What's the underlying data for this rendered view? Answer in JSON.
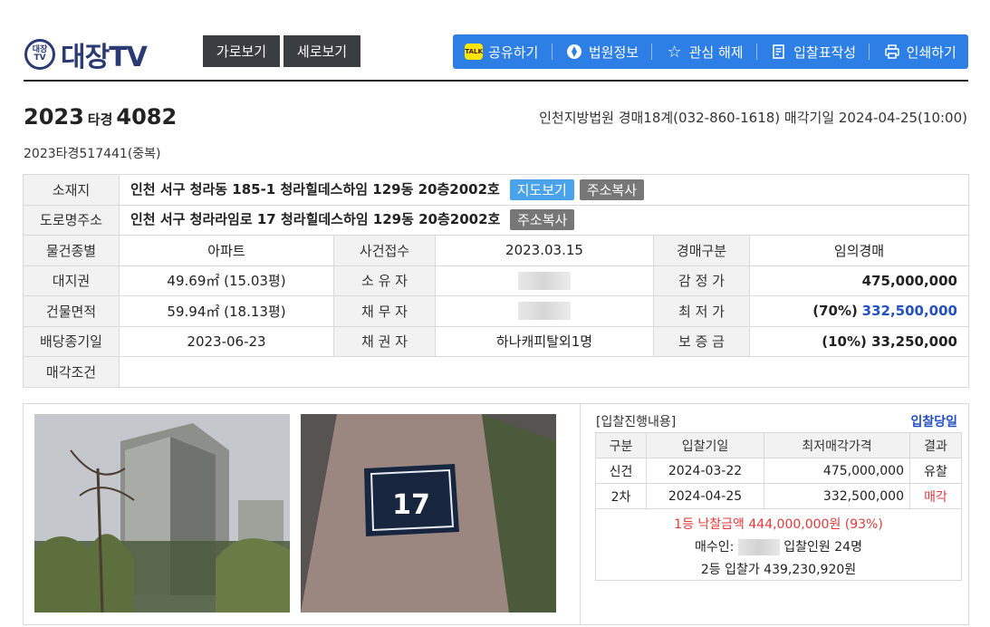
{
  "brand": {
    "logo_mark": "대장\nTV",
    "logo_text": "대장TV"
  },
  "view_buttons": {
    "horizontal": "가로보기",
    "vertical": "세로보기"
  },
  "toolbar": {
    "share": "공유하기",
    "court_info": "법원정보",
    "unfavorite": "관심 해제",
    "bid_form": "입찰표작성",
    "print": "인쇄하기",
    "kakao_icon_text": "TALK"
  },
  "case": {
    "year": "2023",
    "type": "타경",
    "number": "4082",
    "court_info": "인천지방법원 경매18계(032-860-1618) 매각기일 2024-04-25(10:00)",
    "duplicate": "2023타경517441(중복)"
  },
  "info": {
    "location_label": "소재지",
    "location": "인천 서구 청라동 185-1 청라힐데스하임 129동 20층2002호",
    "map_btn": "지도보기",
    "copy_btn": "주소복사",
    "road_label": "도로명주소",
    "road": "인천 서구 청라라임로 17 청라힐데스하임 129동 20층2002호",
    "kind_label": "물건종별",
    "kind": "아파트",
    "receipt_label": "사건접수",
    "receipt": "2023.03.15",
    "auction_type_label": "경매구분",
    "auction_type": "임의경매",
    "land_label": "대지권",
    "land": "49.69㎡ (15.03평)",
    "owner_label": "소 유 자",
    "appraisal_label": "감 정 가",
    "appraisal": "475,000,000",
    "building_label": "건물면적",
    "building": "59.94㎡ (18.13평)",
    "debtor_label": "채 무 자",
    "min_price_label": "최 저 가",
    "min_price_pct": "(70%)",
    "min_price": "332,500,000",
    "deadline_label": "배당종기일",
    "deadline": "2023-06-23",
    "creditor_label": "채 권 자",
    "creditor": "하나캐피탈외1명",
    "deposit_label": "보 증 금",
    "deposit": "(10%) 33,250,000",
    "condition_label": "매각조건"
  },
  "bids": {
    "title": "[입찰진행내용]",
    "link": "입찰당일",
    "headers": [
      "구분",
      "입찰기일",
      "최저매각가격",
      "결과"
    ],
    "rows": [
      {
        "round": "신건",
        "date": "2024-03-22",
        "price": "475,000,000",
        "result": "유찰"
      },
      {
        "round": "2차",
        "date": "2024-04-25",
        "price": "332,500,000",
        "result": "매각"
      }
    ],
    "winning": "1등 낙찰금액 444,000,000원 (93%)",
    "buyer_label": "매수인:",
    "bidders": "입찰인원 24명",
    "second": "2등 입찰가 439,230,920원"
  },
  "photo": {
    "plate_number": "17"
  },
  "colors": {
    "accent": "#2d7fe6",
    "brand": "#2a3b73",
    "sold": "#e23a3a",
    "link": "#2451c2"
  }
}
